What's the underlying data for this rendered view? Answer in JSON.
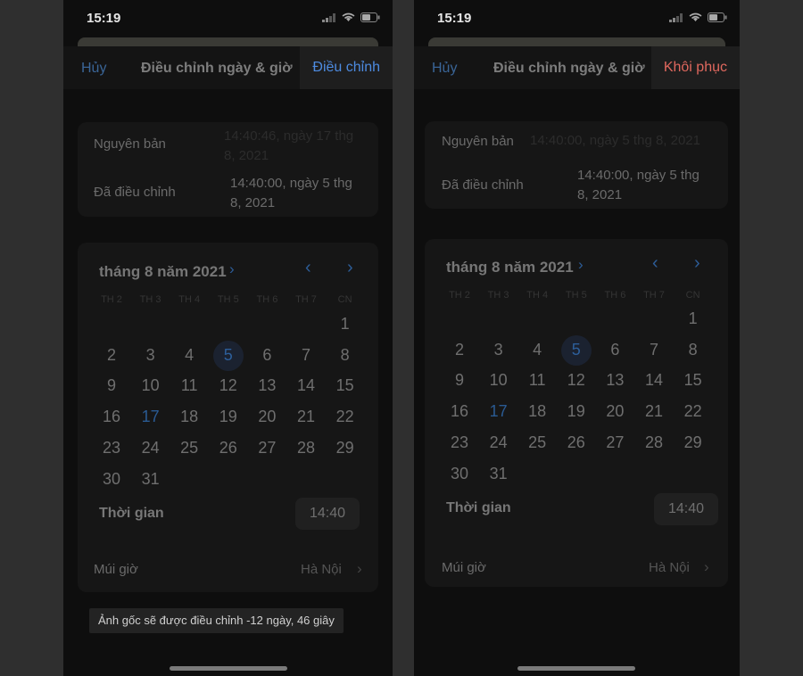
{
  "status": {
    "time": "15:19"
  },
  "common": {
    "cancel": "Hủy",
    "title": "Điều chỉnh ngày & giờ",
    "original_label": "Nguyên bản",
    "adjusted_label": "Đã điều chỉnh",
    "month_title": "tháng 8 năm 2021",
    "weekdays": [
      "TH 2",
      "TH 3",
      "TH 4",
      "TH 5",
      "TH 6",
      "TH 7",
      "CN"
    ],
    "time_label": "Thời gian",
    "time_value": "14:40",
    "timezone_label": "Múi giờ",
    "timezone_value": "Hà Nội",
    "days": [
      "1",
      "2",
      "3",
      "4",
      "5",
      "6",
      "7",
      "8",
      "9",
      "10",
      "11",
      "12",
      "13",
      "14",
      "15",
      "16",
      "17",
      "18",
      "19",
      "20",
      "21",
      "22",
      "23",
      "24",
      "25",
      "26",
      "27",
      "28",
      "29",
      "30",
      "31"
    ]
  },
  "left": {
    "action": "Điều chỉnh",
    "action_color": "#4d8be0",
    "original_line1": "14:40:46, ngày 17 thg",
    "original_line2": "8, 2021",
    "adjusted_line1": "14:40:00, ngày 5 thg",
    "adjusted_line2": "8, 2021",
    "toast": "Ảnh gốc sẽ được điều chỉnh -12 ngày, 46 giây"
  },
  "right": {
    "action": "Khôi phục",
    "action_color": "#e0685e",
    "original_line1": "14:40:00, ngày 5 thg 8, 2021",
    "adjusted_line1": "14:40:00, ngày 5 thg",
    "adjusted_line2": "8, 2021"
  }
}
